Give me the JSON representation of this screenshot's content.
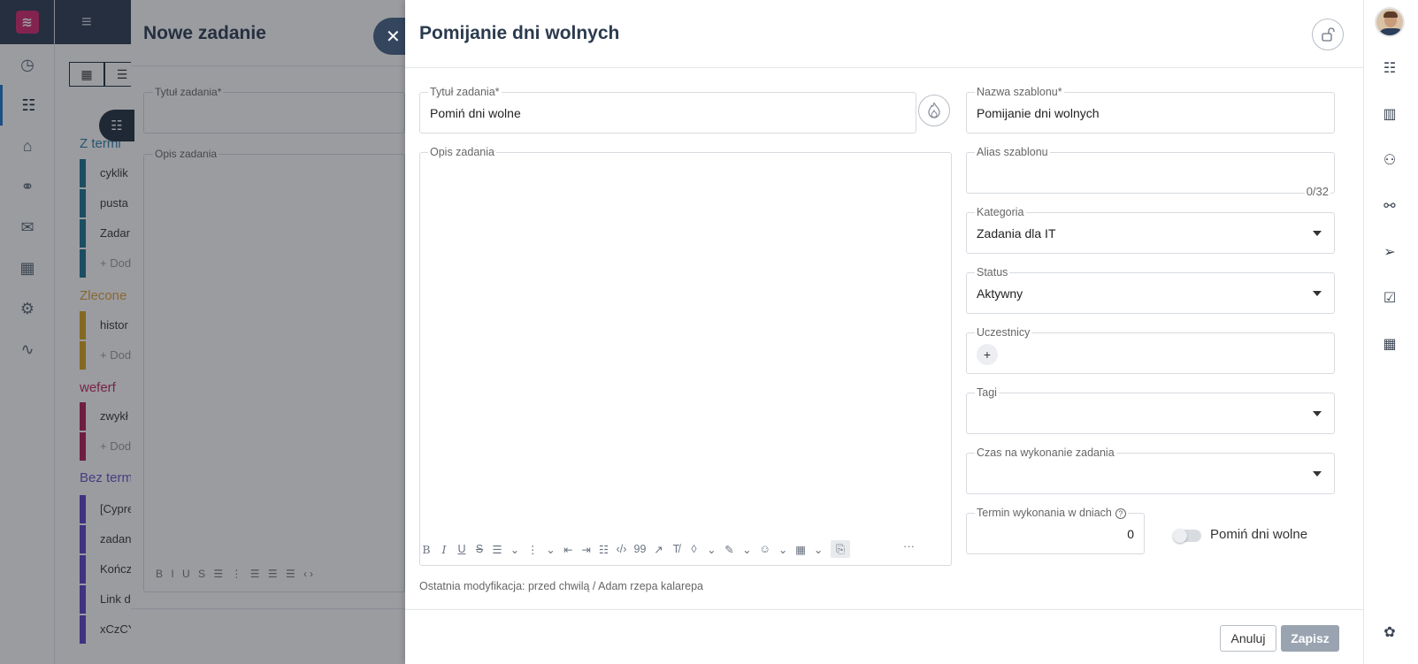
{
  "background": {
    "drawer_title": "Nowe zadanie",
    "field_title_label": "Tytuł zadania*",
    "field_desc_label": "Opis zadania",
    "sections": [
      {
        "label": "Z termi",
        "color": "#2f7ea8"
      },
      {
        "label": "Zlecone",
        "color": "#e0a13a"
      },
      {
        "label": "weferf",
        "color": "#c2255c"
      },
      {
        "label": "Bez term",
        "color": "#6a4fc9"
      }
    ],
    "rows": [
      "cyklik",
      "pusta",
      "Zadar",
      "+ Dod",
      "histor",
      "+ Dod",
      "zwykł",
      "+ Dod",
      "[Cypre",
      "zadan",
      "Kończ",
      "Link d",
      "xCzCY"
    ]
  },
  "modal": {
    "title": "Pomijanie dni wolnych",
    "task_title": {
      "label": "Tytuł zadania*",
      "value": "Pomiń dni wolne"
    },
    "description": {
      "label": "Opis zadania",
      "value": ""
    },
    "template_name": {
      "label": "Nazwa szablonu*",
      "value": "Pomijanie dni wolnych"
    },
    "template_alias": {
      "label": "Alias szablonu",
      "value": "",
      "counter": "0/32"
    },
    "category": {
      "label": "Kategoria",
      "value": "Zadania dla IT"
    },
    "status": {
      "label": "Status",
      "value": "Aktywny"
    },
    "participants": {
      "label": "Uczestnicy",
      "add": "+"
    },
    "tags": {
      "label": "Tagi",
      "value": ""
    },
    "time": {
      "label": "Czas na wykonanie zadania",
      "value": ""
    },
    "deadline": {
      "label": "Termin wykonania w dniach",
      "value": "0"
    },
    "skip_toggle": {
      "label": "Pomiń dni wolne",
      "on": false
    },
    "last_modified": "Ostatnia modyfikacja: przed chwilą / Adam rzepa kalarepa",
    "cancel_label": "Anuluj",
    "save_label": "Zapisz"
  },
  "colors": {
    "accent": "#2b3a4f",
    "brand": "#d6266e",
    "save_disabled": "#9aa3b0"
  }
}
